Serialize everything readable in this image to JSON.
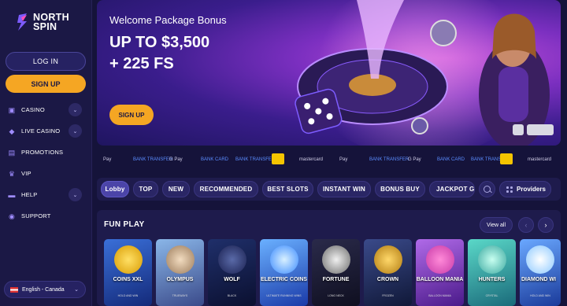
{
  "brand": {
    "line1": "NORTH",
    "line2": "SPIN"
  },
  "auth": {
    "login_label": "LOG IN",
    "signup_label": "SIGN UP"
  },
  "nav": [
    {
      "label": "CASINO",
      "icon": "casino-icon",
      "has_chevron": true
    },
    {
      "label": "LIVE CASINO",
      "icon": "live-casino-icon",
      "has_chevron": true
    },
    {
      "label": "PROMOTIONS",
      "icon": "gift-icon",
      "has_chevron": false
    },
    {
      "label": "VIP",
      "icon": "crown-icon",
      "has_chevron": false
    },
    {
      "label": "HELP",
      "icon": "help-icon",
      "has_chevron": true
    },
    {
      "label": "SUPPORT",
      "icon": "support-icon",
      "has_chevron": false
    }
  ],
  "language": {
    "label": "English - Canada"
  },
  "hero": {
    "title": "Welcome Package Bonus",
    "amount_line1": "UP TO $3,500",
    "amount_line2": "+ 225 FS",
    "cta_label": "SIGN UP"
  },
  "payments": [
    "Pay",
    "BANK TRANSFER",
    "G Pay",
    "BANK CARD",
    "BANK TRANSFER",
    "",
    "mastercard",
    "Pay",
    "BANK TRANSFER",
    "G Pay",
    "BANK CARD",
    "BANK TRANSFER",
    "",
    "mastercard"
  ],
  "categories": [
    "Lobby",
    "TOP",
    "NEW",
    "RECOMMENDED",
    "BEST SLOTS",
    "INSTANT WIN",
    "BONUS BUY",
    "JACKPOT GA"
  ],
  "providers_label": "Providers",
  "fun_play": {
    "title": "FUN PLAY",
    "view_all_label": "View all",
    "games": [
      {
        "name": "COINS XXL",
        "sub": "HOLD AND WIN"
      },
      {
        "name": "OLYMPUS",
        "sub": "TRUEWAYS"
      },
      {
        "name": "WOLF",
        "sub": "BLACK"
      },
      {
        "name": "ELECTRIC COINS",
        "sub": "ULTIMATE RUNNING WINS"
      },
      {
        "name": "FORTUNE",
        "sub": "LONG NECK"
      },
      {
        "name": "CROWN",
        "sub": "FROZEN"
      },
      {
        "name": "BALLOON MANIA",
        "sub": "BALLOON MANIA"
      },
      {
        "name": "HUNTERS",
        "sub": "CRYSTAL"
      },
      {
        "name": "DIAMOND WI",
        "sub": "HOLD AND WIN"
      }
    ]
  },
  "colors": {
    "accent": "#f5a623",
    "sidebar": "#1b1845",
    "page": "#15133a"
  }
}
